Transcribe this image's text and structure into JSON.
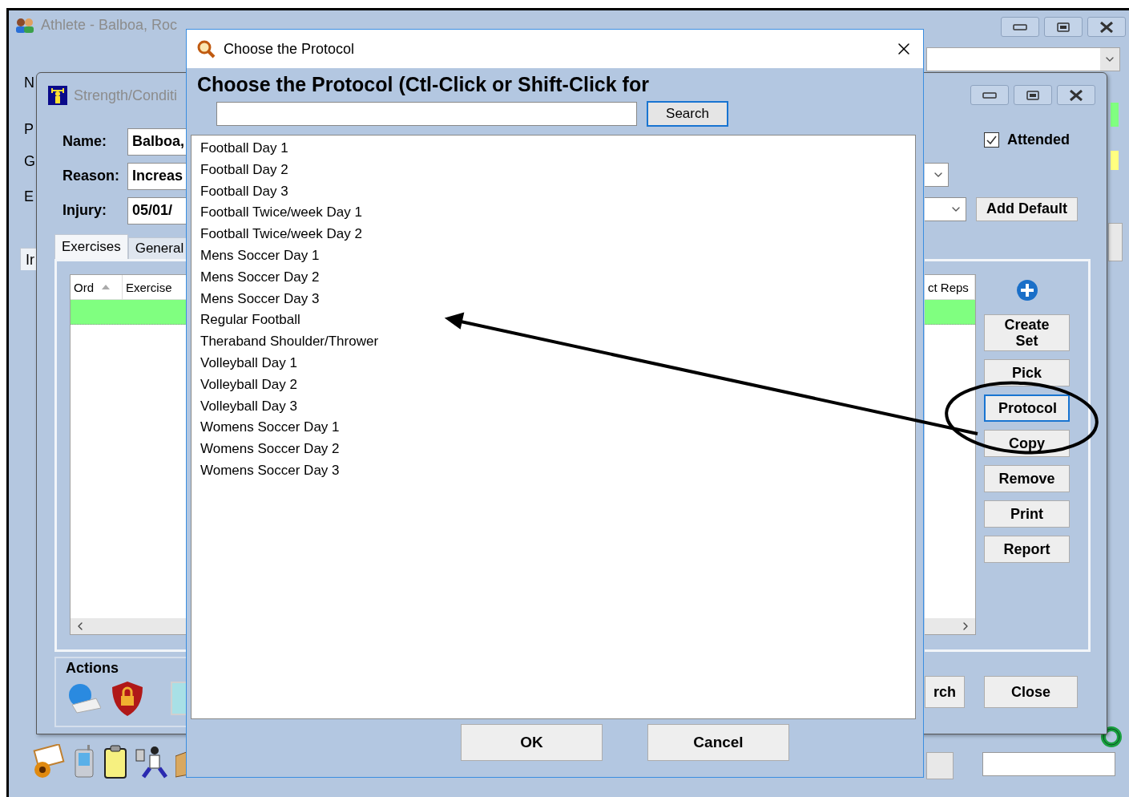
{
  "back_window": {
    "title": "Athlete - Balboa, Roc",
    "label_fragments": [
      "N",
      "P",
      "G",
      "E"
    ],
    "tab_fragment": "Ir"
  },
  "form_window": {
    "title": "Strength/Conditi",
    "fields": [
      {
        "label": "Name:",
        "value": "Balboa,"
      },
      {
        "label": "Reason:",
        "value": "Increas"
      },
      {
        "label": "Injury:",
        "value": "05/01/"
      }
    ],
    "attended": {
      "label": "Attended",
      "checked": true
    },
    "add_default": "Add Default",
    "tabs": [
      {
        "label": "Exercises",
        "selected": true
      },
      {
        "label": "General",
        "selected": false
      }
    ],
    "grid": {
      "columns": [
        "Ord",
        "Exercise",
        "ct Reps"
      ]
    },
    "side_buttons": [
      {
        "label": "Create Set",
        "focused": false
      },
      {
        "label": "Pick",
        "focused": false
      },
      {
        "label": "Protocol",
        "focused": true
      },
      {
        "label": "Copy",
        "focused": false
      },
      {
        "label": "Remove",
        "focused": false
      },
      {
        "label": "Print",
        "focused": false
      },
      {
        "label": "Report",
        "focused": false
      }
    ],
    "actions_label": "Actions",
    "bottom_buttons": [
      "rch",
      "Close"
    ]
  },
  "dialog": {
    "title": "Choose the Protocol",
    "heading": "Choose the Protocol (Ctl-Click or Shift-Click for",
    "search_button": "Search",
    "items": [
      "Football Day 1",
      "Football Day 2",
      "Football Day 3",
      "Football Twice/week Day 1",
      "Football Twice/week Day 2",
      "Mens Soccer Day 1",
      "Mens Soccer Day 2",
      "Mens Soccer Day 3",
      "Regular Football",
      "Theraband Shoulder/Thrower",
      "Volleyball Day 1",
      "Volleyball Day 2",
      "Volleyball Day 3",
      "Womens Soccer Day 1",
      "Womens Soccer Day 2",
      "Womens Soccer Day 3"
    ],
    "buttons": [
      "OK",
      "Cancel"
    ]
  }
}
